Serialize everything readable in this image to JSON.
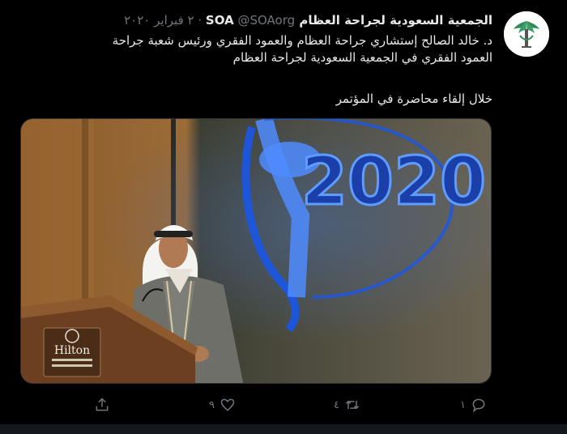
{
  "tweet": {
    "display_name": "الجمعية السعودية لجراحة العظام SOA",
    "handle": "@SOAorg",
    "separator": "·",
    "date": "٢ فبراير ٢٠٢٠",
    "text_lines": [
      "د. خالد الصالح إستشاري جراحة العظام والعمود الفقري ورئيس شعبة جراحة",
      "العمود الفقري في الجمعية السعودية لجراحة العظام",
      "خلال إلقاء محاضرة في المؤتمر"
    ],
    "media": {
      "banner_text": "2020",
      "podium_brand": "Hilton"
    },
    "actions": {
      "reply_count": "١",
      "retweet_count": "٤",
      "like_count": "٩",
      "share_count": ""
    }
  },
  "colors": {
    "background": "#000000",
    "text": "#e7e9ea",
    "muted": "#71767b",
    "accent_blue": "#2a5fe0"
  }
}
